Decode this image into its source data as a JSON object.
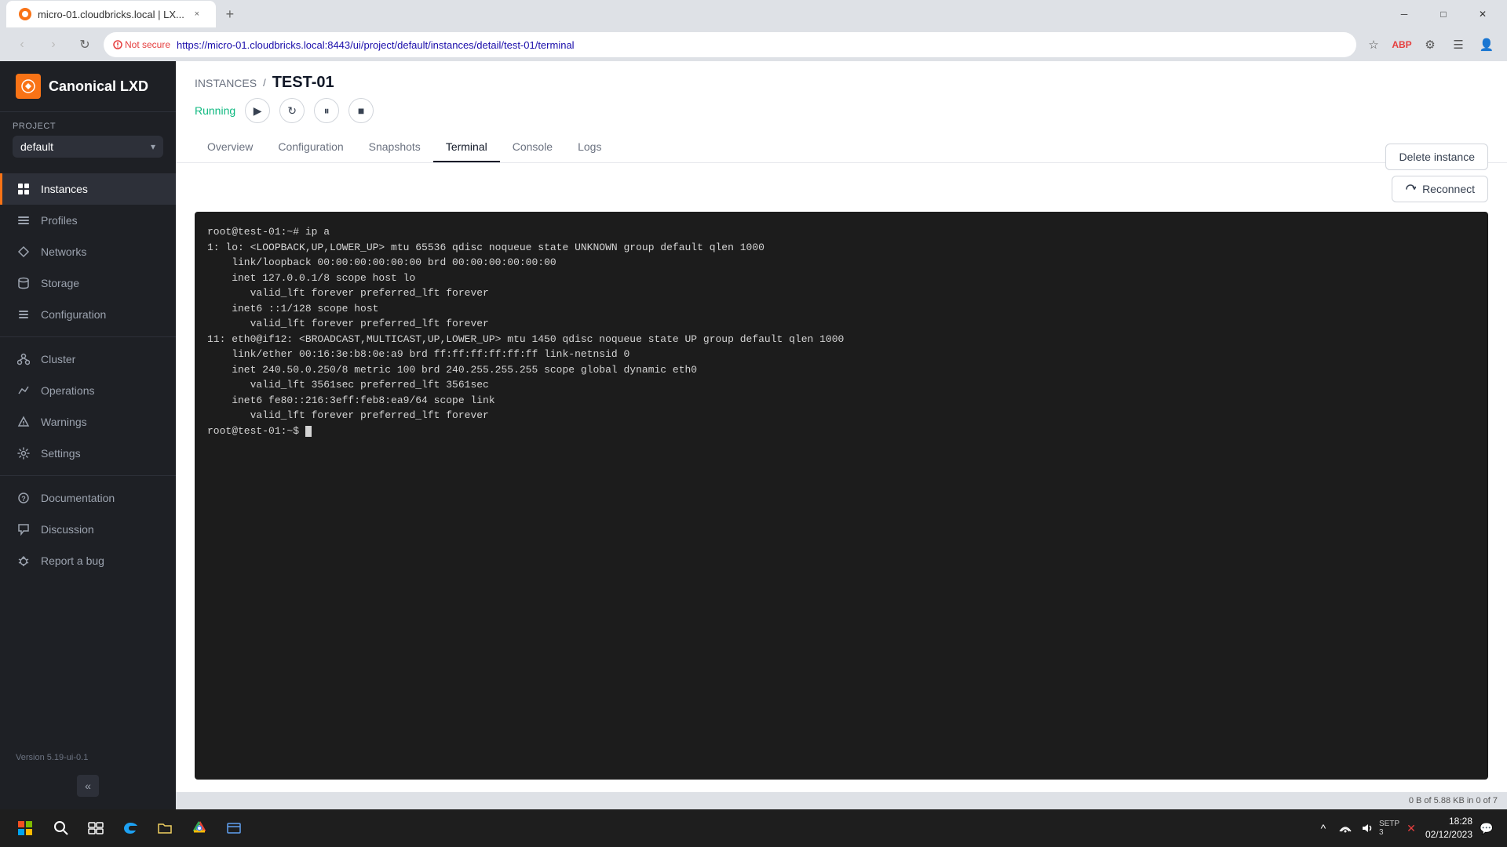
{
  "browser": {
    "tab": {
      "favicon_color": "#f97316",
      "title": "micro-01.cloudbricks.local | LX...",
      "close_label": "×"
    },
    "new_tab_label": "+",
    "window_controls": {
      "minimize": "─",
      "maximize": "□",
      "close": "✕"
    },
    "nav": {
      "back_label": "‹",
      "forward_label": "›",
      "reload_label": "↻"
    },
    "address_bar": {
      "security_label": "Not secure",
      "url": "https://micro-01.cloudbricks.local:8443/ui/project/default/instances/detail/test-01/terminal"
    }
  },
  "sidebar": {
    "logo_text": "Canonical LXD",
    "project_label": "Project",
    "project_name": "default",
    "nav_items": [
      {
        "id": "instances",
        "label": "Instances",
        "active": true
      },
      {
        "id": "profiles",
        "label": "Profiles",
        "active": false
      },
      {
        "id": "networks",
        "label": "Networks",
        "active": false
      },
      {
        "id": "storage",
        "label": "Storage",
        "active": false
      },
      {
        "id": "configuration",
        "label": "Configuration",
        "active": false
      }
    ],
    "bottom_nav": [
      {
        "id": "cluster",
        "label": "Cluster"
      },
      {
        "id": "operations",
        "label": "Operations"
      },
      {
        "id": "warnings",
        "label": "Warnings"
      },
      {
        "id": "settings",
        "label": "Settings"
      }
    ],
    "help_nav": [
      {
        "id": "documentation",
        "label": "Documentation"
      },
      {
        "id": "discussion",
        "label": "Discussion"
      },
      {
        "id": "report-bug",
        "label": "Report a bug"
      }
    ],
    "version": "Version 5.19-ui-0.1"
  },
  "header": {
    "breadcrumb_parent": "INSTANCES",
    "breadcrumb_sep": "/",
    "breadcrumb_current": "TEST-01",
    "status": "Running",
    "delete_btn_label": "Delete instance"
  },
  "tabs": [
    {
      "id": "overview",
      "label": "Overview",
      "active": false
    },
    {
      "id": "configuration",
      "label": "Configuration",
      "active": false
    },
    {
      "id": "snapshots",
      "label": "Snapshots",
      "active": false
    },
    {
      "id": "terminal",
      "label": "Terminal",
      "active": true
    },
    {
      "id": "console",
      "label": "Console",
      "active": false
    },
    {
      "id": "logs",
      "label": "Logs",
      "active": false
    }
  ],
  "terminal": {
    "reconnect_label": "Reconnect",
    "content": [
      "root@test-01:~# ip a",
      "1: lo: <LOOPBACK,UP,LOWER_UP> mtu 65536 qdisc noqueue state UNKNOWN group default qlen 1000",
      "    link/loopback 00:00:00:00:00:00 brd 00:00:00:00:00:00",
      "    inet 127.0.0.1/8 scope host lo",
      "       valid_lft forever preferred_lft forever",
      "    inet6 ::1/128 scope host",
      "       valid_lft forever preferred_lft forever",
      "11: eth0@if12: <BROADCAST,MULTICAST,UP,LOWER_UP> mtu 1450 qdisc noqueue state UP group default qlen 1000",
      "    link/ether 00:16:3e:b8:0e:a9 brd ff:ff:ff:ff:ff:ff link-netnsid 0",
      "    inet 240.50.0.250/8 metric 100 brd 240.255.255.255 scope global dynamic eth0",
      "       valid_lft 3561sec preferred_lft 3561sec",
      "    inet6 fe80::216:3eff:feb8:ea9/64 scope link",
      "       valid_lft forever preferred_lft forever",
      "root@test-01:~$ "
    ]
  },
  "status_bar": {
    "storage_info": "0 B of 5.88 KB in 0 of 7"
  },
  "taskbar": {
    "clock_time": "18:28",
    "clock_date": "02/12/2023",
    "network_label": "SETP 3"
  }
}
